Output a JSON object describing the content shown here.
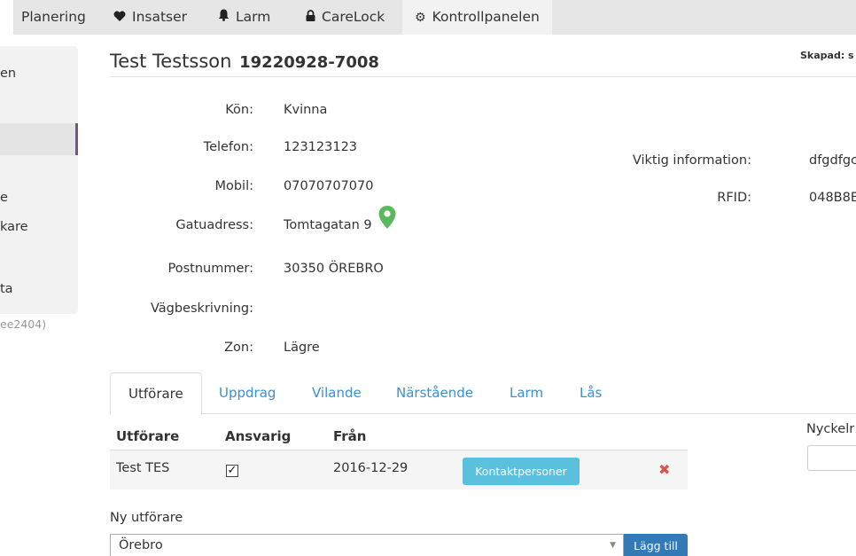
{
  "nav": {
    "items": [
      {
        "label": "Planering",
        "icon": ""
      },
      {
        "label": "Insatser",
        "icon": "heart-icon"
      },
      {
        "label": "Larm",
        "icon": "bell-icon"
      },
      {
        "label": "CareLock",
        "icon": "lock-icon"
      },
      {
        "label": "Kontrollpanelen",
        "icon": "cogs-icon"
      }
    ]
  },
  "sidebar": {
    "items": [
      "en",
      "e",
      "kare",
      "ta"
    ],
    "footer": "ee2404)"
  },
  "header": {
    "name": "Test Testsson",
    "personnummer": "19220928-7008",
    "created_label": "Skapad: s"
  },
  "info": {
    "kon_label": "Kön:",
    "kon_value": "Kvinna",
    "telefon_label": "Telefon:",
    "telefon_value": "123123123",
    "mobil_label": "Mobil:",
    "mobil_value": "07070707070",
    "gatuadress_label": "Gatuadress:",
    "gatuadress_value": "Tomtagatan 9",
    "postnummer_label": "Postnummer:",
    "postnummer_value": "30350 ÖREBRO",
    "vagbeskrivning_label": "Vägbeskrivning:",
    "zon_label": "Zon:",
    "zon_value": "Lägre",
    "viktig_label": "Viktig information:",
    "viktig_value": "dfgdfgc",
    "rfid_label": "RFID:",
    "rfid_value": "048B8E"
  },
  "tabs": [
    "Utförare",
    "Uppdrag",
    "Vilande",
    "Närstående",
    "Larm",
    "Lås"
  ],
  "table": {
    "headers": [
      "Utförare",
      "Ansvarig",
      "Från"
    ],
    "rows": [
      {
        "utforare": "Test TES",
        "ansvarig": true,
        "fran": "2016-12-29",
        "button": "Kontaktpersoner"
      }
    ]
  },
  "ny_utforare": {
    "label": "Ny utförare",
    "selected": "Örebro",
    "add_label": "Lägg till"
  },
  "right": {
    "nyckel_label": "Nyckelr"
  },
  "colors": {
    "accent_blue": "#3a8fd6",
    "button_info": "#5bc0de",
    "button_primary": "#337ab7",
    "pin_green": "#5cb85c",
    "delete_red": "#d9534f"
  }
}
